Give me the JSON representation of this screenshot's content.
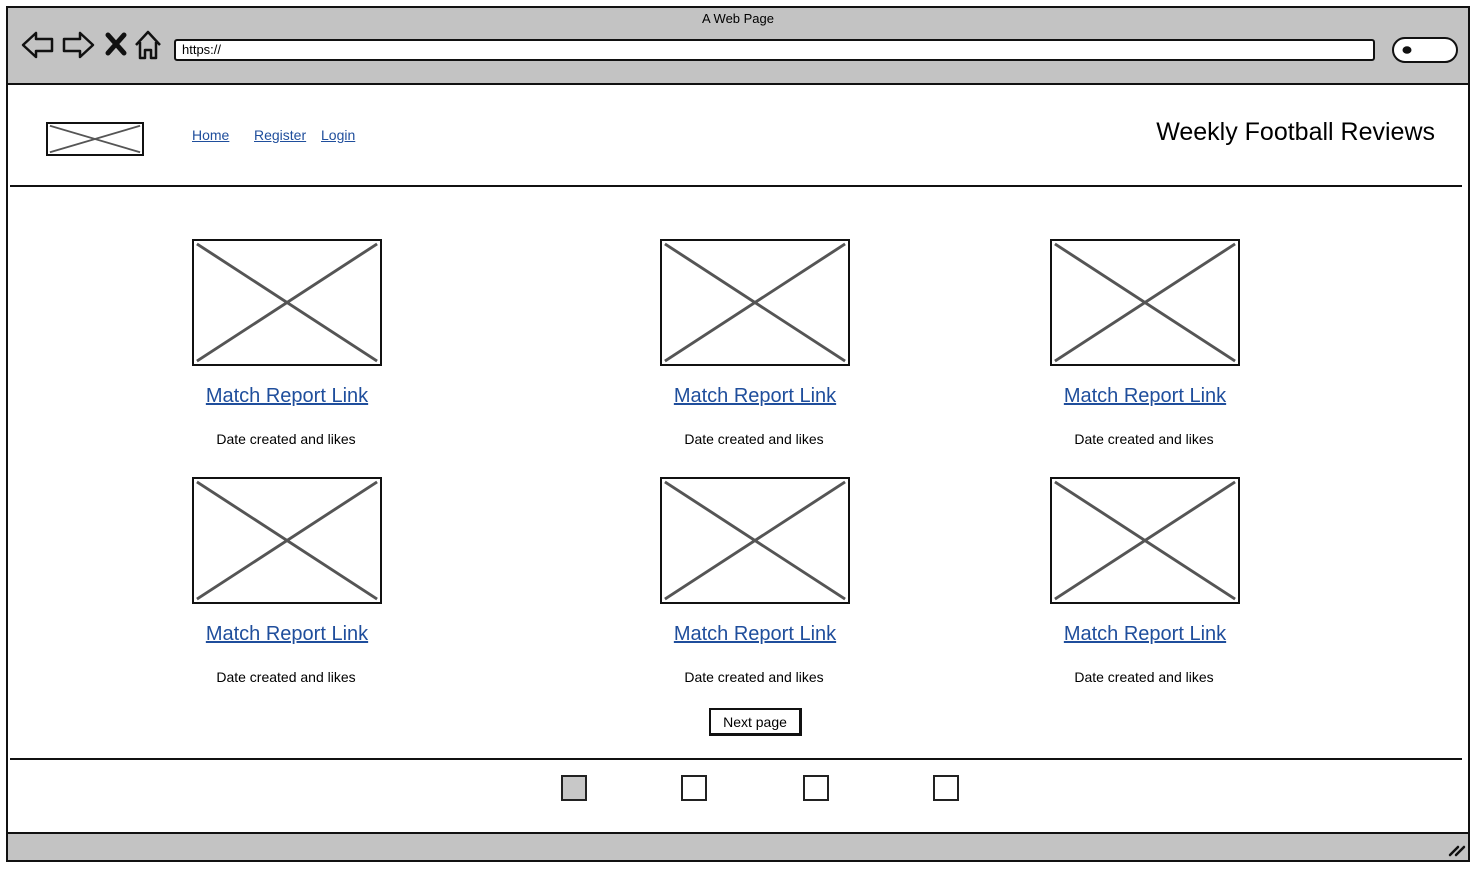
{
  "browser": {
    "window_title": "A Web Page",
    "url": "https://"
  },
  "header": {
    "nav": [
      "Home",
      "Register",
      "Login"
    ],
    "site_title": "Weekly Football Reviews"
  },
  "cards": [
    {
      "link": "Match Report Link",
      "meta": "Date created and likes"
    },
    {
      "link": "Match Report Link",
      "meta": "Date created and likes"
    },
    {
      "link": "Match Report Link",
      "meta": "Date created and likes"
    },
    {
      "link": "Match Report Link",
      "meta": "Date created and likes"
    },
    {
      "link": "Match Report Link",
      "meta": "Date created and likes"
    },
    {
      "link": "Match Report Link",
      "meta": "Date created and likes"
    }
  ],
  "pagination": {
    "next_label": "Next page",
    "active_index": 0
  },
  "colors": {
    "chrome": "#c3c3c3",
    "link": "#1f4e9c"
  }
}
